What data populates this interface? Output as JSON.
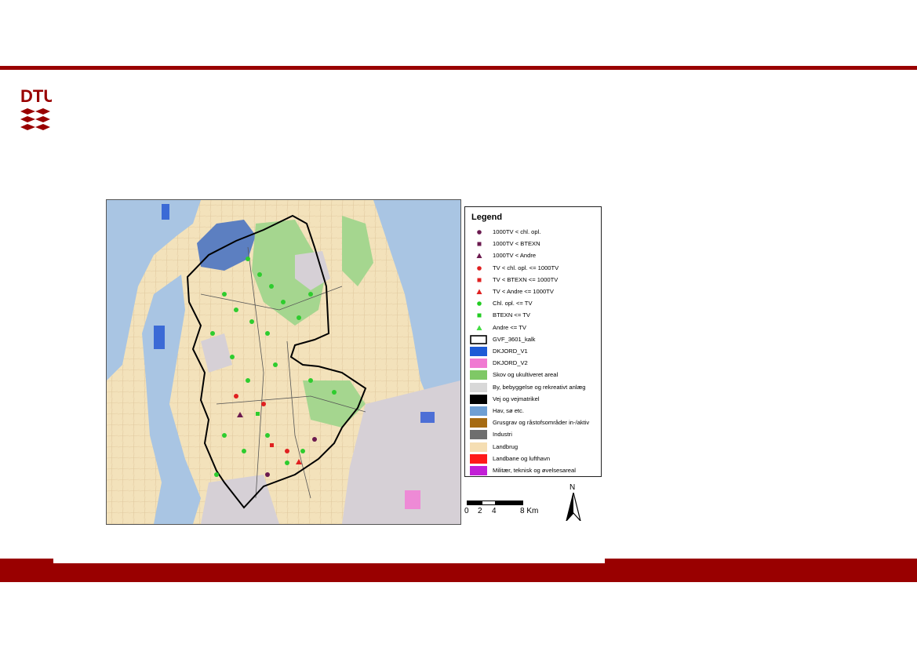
{
  "colors": {
    "brand": "#990000",
    "agriculture": "#f5deb3",
    "forest": "#9ed18c",
    "urban": "#d9d9d9",
    "water": "#a7c7e7"
  },
  "logo": {
    "text": "DTU"
  },
  "legend": {
    "title": "Legend",
    "items": [
      {
        "label": "1000TV < chl. opl.",
        "symbol": "circle",
        "color": "#6b1a4f"
      },
      {
        "label": "1000TV < BTEXN",
        "symbol": "square",
        "color": "#6b1a4f"
      },
      {
        "label": "1000TV < Andre",
        "symbol": "triangle",
        "color": "#6b1a4f"
      },
      {
        "label": "TV < chl. opl. <= 1000TV",
        "symbol": "circle",
        "color": "#e02020"
      },
      {
        "label": "TV < BTEXN <= 1000TV",
        "symbol": "square",
        "color": "#e02020"
      },
      {
        "label": "TV < Andre <= 1000TV",
        "symbol": "triangle",
        "color": "#e02020"
      },
      {
        "label": "Chl. opl. <= TV",
        "symbol": "circle",
        "color": "#22cc22"
      },
      {
        "label": "BTEXN <= TV",
        "symbol": "square",
        "color": "#22cc22"
      },
      {
        "label": "Andre <= TV",
        "symbol": "triangle",
        "color": "#44dd44"
      },
      {
        "label": "GVF_3601_kalk",
        "symbol": "outline",
        "color": "#000000"
      },
      {
        "label": "DKJORD_V1",
        "symbol": "fill",
        "color": "#1e5bd6"
      },
      {
        "label": "DKJORD_V2",
        "symbol": "fill",
        "color": "#f07ad2"
      },
      {
        "label": "Skov og ukultiveret areal",
        "symbol": "fill",
        "color": "#7fc866"
      },
      {
        "label": "By, bebyggelse og rekreativt anlæg",
        "symbol": "fill",
        "color": "#d8d8d8"
      },
      {
        "label": "Vej og vejmatrikel",
        "symbol": "fill",
        "color": "#000000"
      },
      {
        "label": "Hav, sø etc.",
        "symbol": "fill",
        "color": "#6f9fd3"
      },
      {
        "label": "Grusgrav og råstofsområder in-/aktiv",
        "symbol": "fill",
        "color": "#a66b12"
      },
      {
        "label": "Industri",
        "symbol": "fill",
        "color": "#6e6e6e"
      },
      {
        "label": "Landbrug",
        "symbol": "fill",
        "color": "#f5deb3"
      },
      {
        "label": "Landbane og lufthavn",
        "symbol": "fill",
        "color": "#ff1a1a"
      },
      {
        "label": "Militær, teknisk og øvelsesareal",
        "symbol": "fill",
        "color": "#c21fd6"
      }
    ]
  },
  "scale": {
    "ticks": [
      "0",
      "2",
      "4",
      "8 Km"
    ]
  },
  "north": {
    "label": "N"
  }
}
